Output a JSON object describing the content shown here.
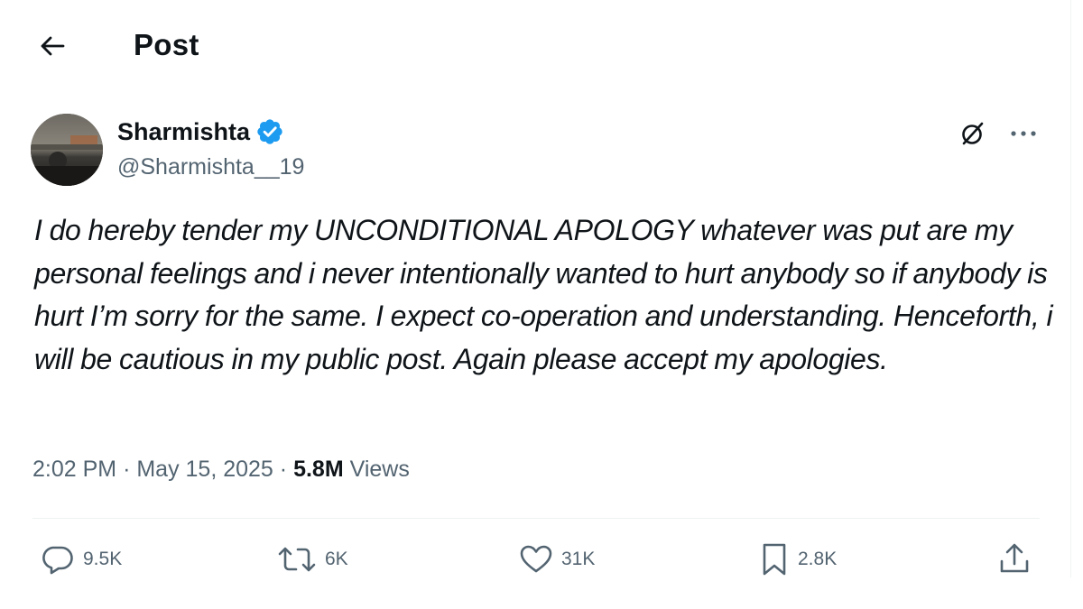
{
  "header": {
    "title": "Post",
    "back_icon": "arrow-left-icon"
  },
  "author": {
    "display_name": "Sharmishta",
    "handle": "@Sharmishta__19",
    "verified": true,
    "verified_color": "#1d9bf0"
  },
  "post": {
    "text": "I do hereby tender my UNCONDITIONAL APOLOGY whatever was put are my personal feelings and i never intentionally wanted to hurt anybody so if anybody is hurt I’m sorry for the same. I expect co-operation and understanding. Henceforth, i will be cautious in my public post. Again please accept my apologies.",
    "time": "2:02 PM",
    "separator": "·",
    "date": "May 15, 2025",
    "views_count": "5.8M",
    "views_label": "Views"
  },
  "actions": {
    "replies": "9.5K",
    "reposts": "6K",
    "likes": "31K",
    "bookmarks": "2.8K"
  },
  "icons": {
    "grok": "grok-icon",
    "more": "more-horizontal-icon",
    "reply": "reply-icon",
    "repost": "repost-icon",
    "like": "heart-icon",
    "bookmark": "bookmark-icon",
    "share": "share-icon"
  },
  "colors": {
    "text_primary": "#0f1419",
    "text_secondary": "#536471",
    "accent": "#1d9bf0",
    "divider": "#eff3f4"
  }
}
